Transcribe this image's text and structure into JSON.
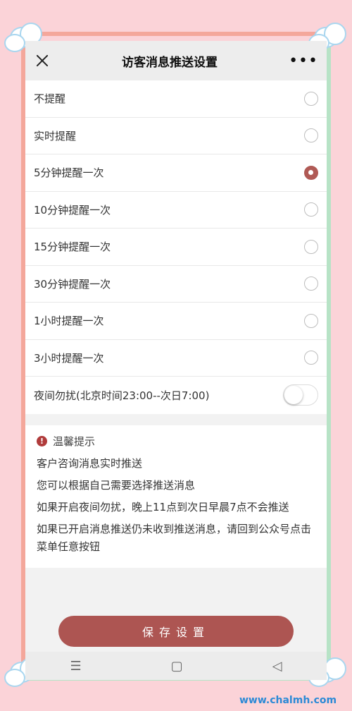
{
  "header": {
    "title": "访客消息推送设置",
    "more": "•••"
  },
  "options": [
    {
      "label": "不提醒",
      "selected": false
    },
    {
      "label": "实时提醒",
      "selected": false
    },
    {
      "label": "5分钟提醒一次",
      "selected": true
    },
    {
      "label": "10分钟提醒一次",
      "selected": false
    },
    {
      "label": "15分钟提醒一次",
      "selected": false
    },
    {
      "label": "30分钟提醒一次",
      "selected": false
    },
    {
      "label": "1小时提醒一次",
      "selected": false
    },
    {
      "label": "3小时提醒一次",
      "selected": false
    }
  ],
  "night_mode": {
    "label": "夜间勿扰(北京时间23:00--次日7:00)",
    "enabled": false
  },
  "tips": {
    "title": "温馨提示",
    "icon": "!",
    "lines": [
      "客户咨询消息实时推送",
      "您可以根据自己需要选择推送消息",
      "如果开启夜间勿扰，晚上11点到次日早晨7点不会推送",
      "如果已开启消息推送仍未收到推送消息，请回到公众号点击菜单任意按钮"
    ]
  },
  "save_button": "保存设置",
  "nav": {
    "menu": "☰",
    "home": "▢",
    "back": "◁"
  },
  "watermark": "www.chalmh.com",
  "colors": {
    "accent": "#ad5552",
    "background": "#fbd3d8"
  }
}
